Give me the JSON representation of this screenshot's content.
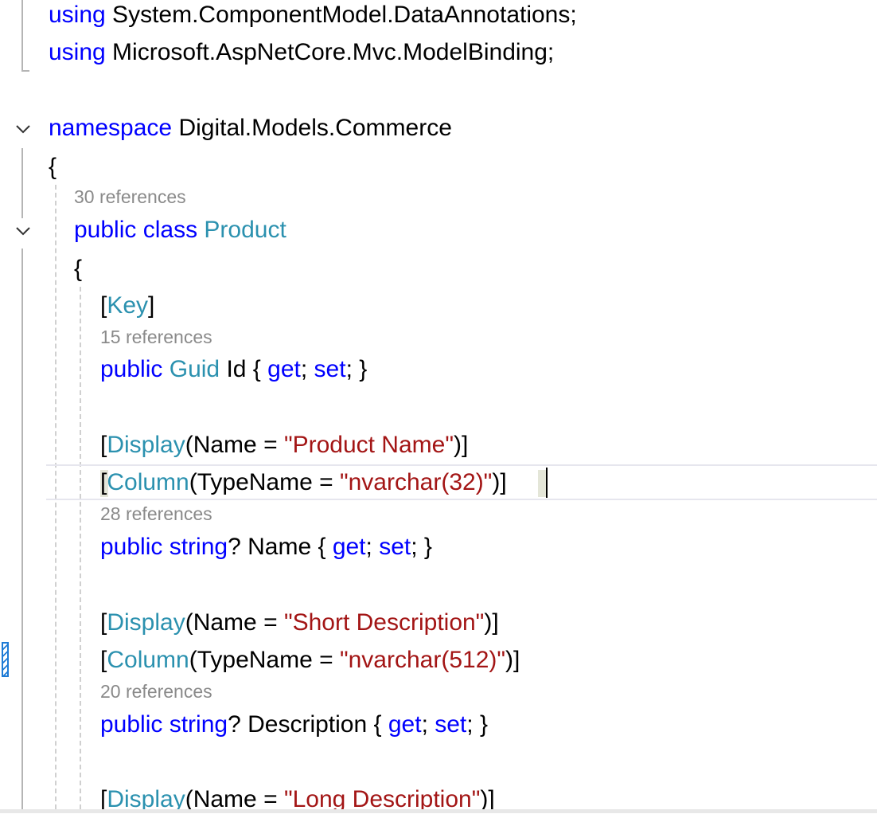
{
  "editor": {
    "colors": {
      "keyword": "#0000ff",
      "type": "#2b91af",
      "string": "#a31515",
      "plain": "#000000",
      "codelens": "#8a8a8a",
      "change_marker": "#1e7bd6"
    },
    "lines": {
      "using1": {
        "kw": "using",
        "rest": " System.ComponentModel.DataAnnotations;"
      },
      "using2": {
        "kw": "using",
        "rest": " Microsoft.AspNetCore.Mvc.ModelBinding;"
      },
      "ns": {
        "kw": "namespace",
        "rest": " Digital.Models.Commerce"
      },
      "ns_open": "{",
      "class_refs": "30 references",
      "class_decl": {
        "kw": "public class",
        "type": "Product"
      },
      "class_open": "{",
      "key_attr": {
        "open": "[",
        "type": "Key",
        "close": "]"
      },
      "id_refs": "15 references",
      "id_prop": {
        "kw1": "public",
        "type": "Guid",
        "name": " Id { ",
        "get": "get",
        "semi1": "; ",
        "set": "set",
        "end": "; }"
      },
      "name_display": {
        "open": "[",
        "type": "Display",
        "mid": "(Name = ",
        "str": "\"Product Name\"",
        "close": ")]"
      },
      "name_column": {
        "open": "[",
        "type": "Column",
        "mid": "(TypeName = ",
        "str": "\"nvarchar(32)\"",
        "close": ")]"
      },
      "name_refs": "28 references",
      "name_prop": {
        "kw1": "public string",
        "name": "? Name { ",
        "get": "get",
        "semi1": "; ",
        "set": "set",
        "end": "; }"
      },
      "desc_display": {
        "open": "[",
        "type": "Display",
        "mid": "(Name = ",
        "str": "\"Short Description\"",
        "close": ")]"
      },
      "desc_column": {
        "open": "[",
        "type": "Column",
        "mid": "(TypeName = ",
        "str": "\"nvarchar(512)\"",
        "close": ")]"
      },
      "desc_refs": "20 references",
      "desc_prop": {
        "kw1": "public string",
        "name": "? Description { ",
        "get": "get",
        "semi1": "; ",
        "set": "set",
        "end": "; }"
      },
      "long_display": {
        "open": "[",
        "type": "Display",
        "mid": "(Name = ",
        "str": "\"Long Description\"",
        "close": ")]"
      }
    }
  }
}
